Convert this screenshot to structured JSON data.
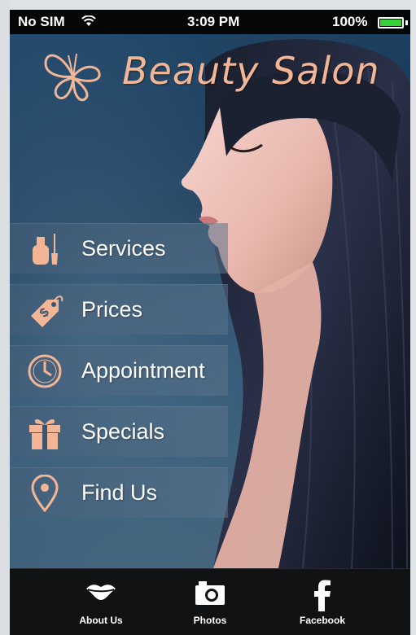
{
  "status_bar": {
    "carrier": "No SIM",
    "time": "3:09 PM",
    "battery": "100%",
    "battery_color": "#36d039"
  },
  "header": {
    "title": "Beauty Salon",
    "logo_icon": "butterfly-icon",
    "accent_color": "#f2b595"
  },
  "menu": {
    "items": [
      {
        "label": "Services",
        "icon": "nail-polish-icon"
      },
      {
        "label": "Prices",
        "icon": "price-tag-icon"
      },
      {
        "label": "Appointment",
        "icon": "clock-icon"
      },
      {
        "label": "Specials",
        "icon": "gift-icon"
      },
      {
        "label": "Find Us",
        "icon": "map-pin-icon"
      }
    ]
  },
  "tab_bar": {
    "tabs": [
      {
        "label": "About Us",
        "icon": "lips-icon"
      },
      {
        "label": "Photos",
        "icon": "camera-icon"
      },
      {
        "label": "Facebook",
        "icon": "facebook-icon"
      }
    ]
  }
}
